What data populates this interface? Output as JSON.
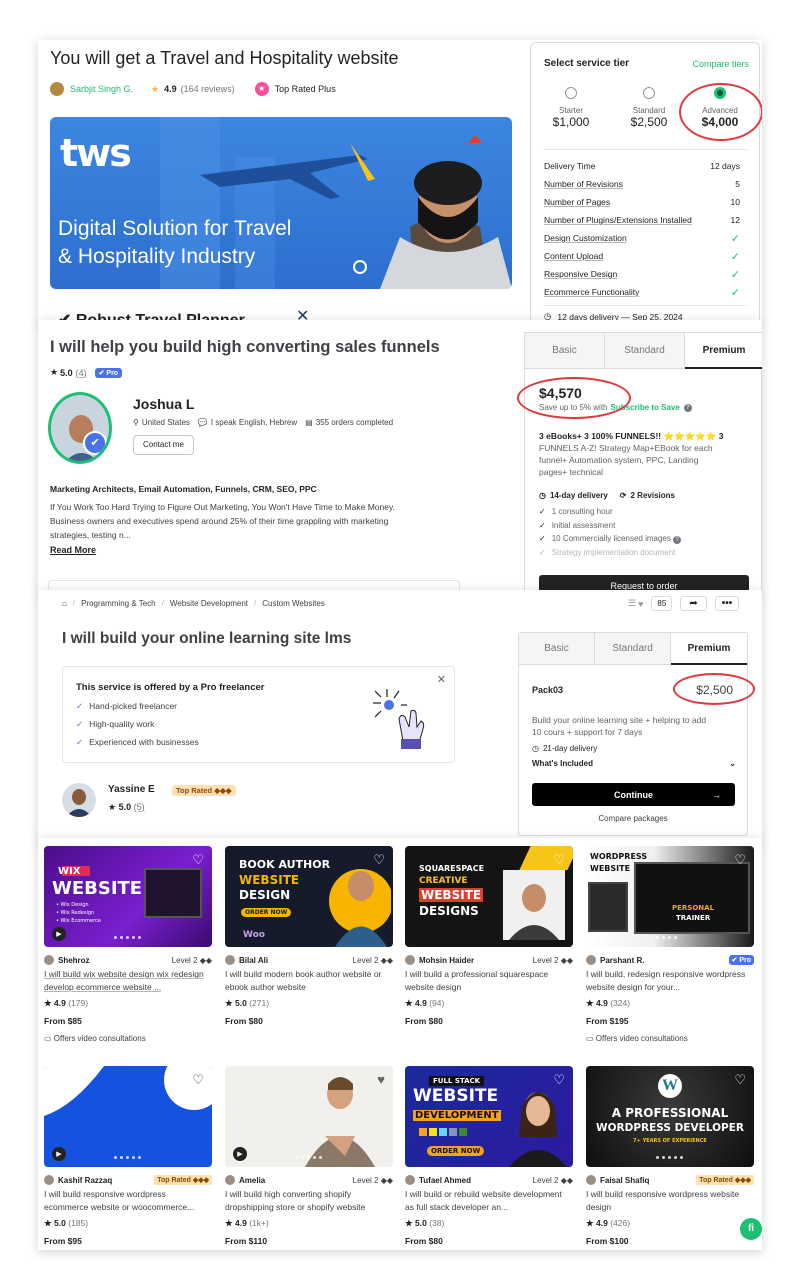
{
  "panel1": {
    "title": "You will get a Travel and Hospitality website",
    "seller_name": "Sarbjit Singh G.",
    "rating": "4.9",
    "reviews": "(164 reviews)",
    "badge": "Top Rated Plus",
    "banner": {
      "logo": "tws",
      "headline_1": "Digital Solution for Travel",
      "headline_2": "& Hospitality Industry",
      "below_text": "✔ Robust Travel Planner"
    },
    "tier_box": {
      "title": "Select service tier",
      "compare": "Compare tiers",
      "tiers": [
        {
          "name": "Starter",
          "price": "$1,000"
        },
        {
          "name": "Standard",
          "price": "$2,500"
        },
        {
          "name": "Advanced",
          "price": "$4,000"
        }
      ],
      "features": [
        {
          "label": "Delivery Time",
          "value": "12 days"
        },
        {
          "label": "Number of Revisions",
          "value": "5"
        },
        {
          "label": "Number of Pages",
          "value": "10"
        },
        {
          "label": "Number of Plugins/Extensions Installed",
          "value": "12"
        },
        {
          "label": "Design Customization",
          "value": "✓"
        },
        {
          "label": "Content Upload",
          "value": "✓"
        },
        {
          "label": "Responsive Design",
          "value": "✓"
        },
        {
          "label": "Ecommerce Functionality",
          "value": "✓"
        }
      ],
      "delivery": "12 days delivery — Sep 25, 2024"
    }
  },
  "panel2": {
    "title": "I will help you build high converting sales funnels",
    "rating": "5.0",
    "rating_count": "(4)",
    "pro": "Pro",
    "seller_name": "Joshua L",
    "country": "United States",
    "languages": "I speak English, Hebrew",
    "orders": "355 orders completed",
    "contact": "Contact me",
    "tags": "Marketing Architects, Email Automation, Funnels, CRM, SEO, PPC",
    "desc_1": "If You Work Too Hard Trying to Figure Out Marketing, You Won't Have Time to Make Money.",
    "desc_2": "Business owners and executives spend around 25% of their time grappling with marketing",
    "desc_3": "strategies, testing n...",
    "read_more": "Read More",
    "tabs": [
      "Basic",
      "Standard",
      "Premium"
    ],
    "price": "$4,570",
    "save_text": "Save up to 5% with",
    "save_link": "Subscribe to Save",
    "package_title": "3 eBooks+ 3 100% FUNNELS!! ⭐⭐⭐⭐⭐ 3",
    "package_desc_1": "FUNNELS A-Z! Strategy Map+EBook for each",
    "package_desc_2": "funnel+ Automation system, PPC, Landing",
    "package_desc_3": "pages+ technical",
    "delivery": "14-day delivery",
    "revisions": "2 Revisions",
    "includes": [
      {
        "label": "1 consulting hour",
        "on": true
      },
      {
        "label": "Initial assessment",
        "on": true
      },
      {
        "label": "10 Commercially licensed images",
        "on": true
      },
      {
        "label": "Strategy implementation document",
        "on": false
      }
    ],
    "cta": "Request to order"
  },
  "panel3": {
    "breadcrumb": [
      "Programming & Tech",
      "Website Development",
      "Custom Websites"
    ],
    "likes": "85",
    "title": "I will build your online learning site lms",
    "pro_box_title": "This service is offered by a Pro freelancer",
    "pro_points": [
      "Hand-picked freelancer",
      "High-quality work",
      "Experienced with businesses"
    ],
    "seller_name": "Yassine E",
    "seller_badge": "Top Rated ◆◆◆",
    "rating": "5.0",
    "rating_count": "(5)",
    "tabs": [
      "Basic",
      "Standard",
      "Premium"
    ],
    "package_name": "Pack03",
    "price": "$2,500",
    "desc_1": "Build your online learning site + helping to add",
    "desc_2": "10 cours + support for 7 days",
    "delivery": "21-day delivery",
    "whats_included": "What's Included",
    "continue": "Continue",
    "compare": "Compare packages"
  },
  "gigs": [
    {
      "seller": "Shehroz",
      "level": "Level 2 ◆◆",
      "title": "I will build wix website design wix redesign develop ecommerce website ...",
      "rating": "4.9",
      "count": "(179)",
      "price": "From $85",
      "video": "Offers video consultations",
      "thumb_1": "WIX",
      "thumb_2": "WEBSITE",
      "thumb_3": "• Wix Design",
      "thumb_4": "• Wix Redesign",
      "thumb_5": "• Wix Ecommerce"
    },
    {
      "seller": "Bilal Ali",
      "level": "Level 2 ◆◆",
      "title": "I will build modern book author website or ebook author website",
      "rating": "5.0",
      "count": "(271)",
      "price": "From $80",
      "thumb_1": "BOOK AUTHOR",
      "thumb_2": "WEBSITE",
      "thumb_3": "DESIGN",
      "thumb_4": "ORDER NOW",
      "thumb_5": "Woo"
    },
    {
      "seller": "Mohsin Haider",
      "level": "Level 2 ◆◆",
      "title": "I will build a professional squarespace website design",
      "rating": "4.9",
      "count": "(94)",
      "price": "From $80",
      "thumb_1": "SQUARESPACE",
      "thumb_2": "CREATIVE",
      "thumb_3": "WEBSITE",
      "thumb_4": "DESIGNS"
    },
    {
      "seller": "Parshant R.",
      "badge": "Pro",
      "title": "I will build, redesign responsive wordpress website design for your...",
      "rating": "4.9",
      "count": "(324)",
      "price": "From $195",
      "video": "Offers video consultations",
      "thumb_1": "WORDPRESS",
      "thumb_2": "WEBSITE",
      "thumb_3": "PERSONAL",
      "thumb_4": "TRAINER"
    },
    {
      "seller": "Kashif Razzaq",
      "badge": "Top Rated ◆◆◆",
      "title": "I will build responsive wordpress ecommerce website or woocommerce...",
      "rating": "5.0",
      "count": "(185)",
      "price": "From $95"
    },
    {
      "seller": "Amelia",
      "level": "Level 2 ◆◆",
      "title": "I will build high converting shopify dropshipping store or shopify website",
      "rating": "4.9",
      "count": "(1k+)",
      "price": "From $110"
    },
    {
      "seller": "Tufael Ahmed",
      "level": "Level 2 ◆◆",
      "title": "I will build or rebuild website development as full stack developer an...",
      "rating": "5.0",
      "count": "(38)",
      "price": "From $80",
      "thumb_1": "FULL STACK",
      "thumb_2": "WEBSITE",
      "thumb_3": "DEVELOPMENT",
      "thumb_4": "ORDER NOW"
    },
    {
      "seller": "Faisal Shafiq",
      "badge": "Top Rated ◆◆◆",
      "title": "I will build responsive wordpress website design",
      "rating": "4.9",
      "count": "(426)",
      "price": "From $100",
      "thumb_1": "A PROFESSIONAL",
      "thumb_2": "WORDPRESS DEVELOPER",
      "thumb_3": "7+ YEARS OF EXPERIENCE"
    }
  ],
  "fab": "fi",
  "colors": {
    "brand_green": "#1dbf73",
    "annotation_red": "#e0383e",
    "pro_blue": "#4a73e8"
  }
}
